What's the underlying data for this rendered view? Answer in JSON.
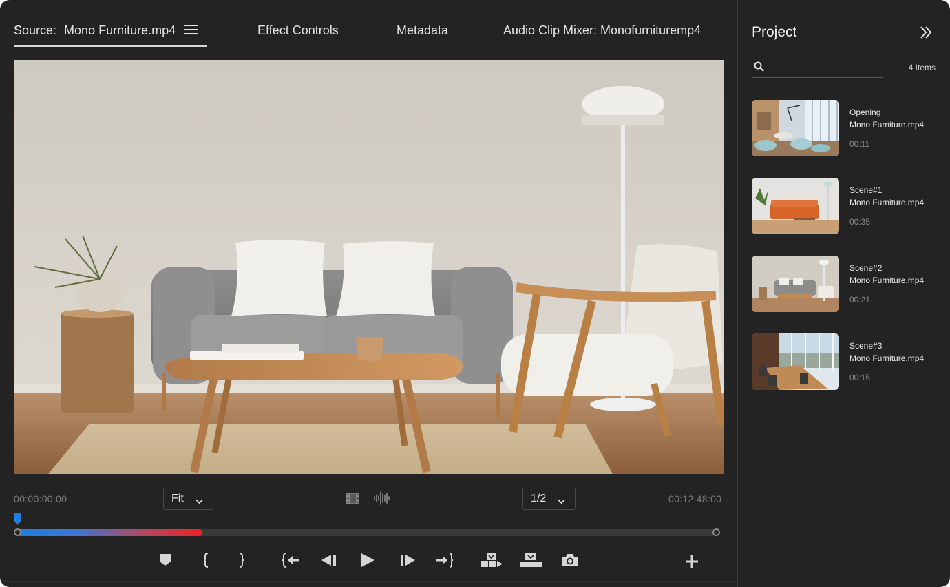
{
  "tabs": {
    "source_prefix": "Source:",
    "source_file": "Mono Furniture.mp4",
    "effect_controls": "Effect Controls",
    "metadata": "Metadata",
    "audio_mixer": "Audio Clip Mixer: Monofurnituremp4"
  },
  "transport": {
    "current_time": "00:00:00:00",
    "duration": "00:12:48:00",
    "zoom": "Fit",
    "resolution": "1/2",
    "progress": 0.265,
    "controls": [
      "marker-icon",
      "mark-in-icon",
      "mark-out-icon",
      "go-to-in-icon",
      "step-back-icon",
      "play-icon",
      "step-forward-icon",
      "go-to-out-icon",
      "insert-icon",
      "overwrite-icon",
      "camera-icon",
      "plus-icon"
    ]
  },
  "colors": {
    "background": "#232323",
    "accent_blue": "#1e7fe0",
    "accent_red": "#ea2324"
  },
  "project": {
    "title": "Project",
    "search_placeholder": "",
    "item_count": "4 Items",
    "items": [
      {
        "name": "Opening",
        "file": "Mono Furniture.mp4",
        "duration": "00:11"
      },
      {
        "name": "Scene#1",
        "file": "Mono Furniture.mp4",
        "duration": "00:35"
      },
      {
        "name": "Scene#2",
        "file": "Mono Furniture.mp4",
        "duration": "00:21"
      },
      {
        "name": "Scene#3",
        "file": "Mono Furniture.mp4",
        "duration": "00:15"
      }
    ]
  }
}
